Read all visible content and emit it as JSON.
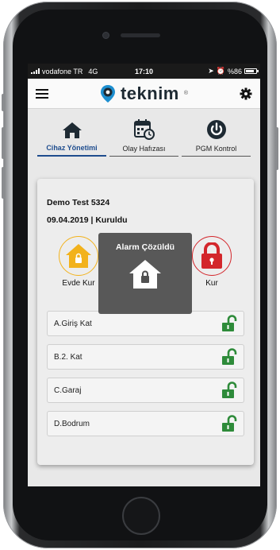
{
  "status_bar": {
    "carrier": "vodafone TR",
    "network": "4G",
    "time": "17:10",
    "battery": "%86",
    "battery_level": 0.86
  },
  "app_bar": {
    "brand": "teknim",
    "brand_mark": "®",
    "brand_color": "#1e2a33",
    "brand_pin_color": "#1d8fd0"
  },
  "tabs": [
    {
      "label": "Cihaz Yönetimi",
      "icon": "home-icon",
      "active": true
    },
    {
      "label": "Olay Hafızası",
      "icon": "calendar-clock-icon",
      "active": false
    },
    {
      "label": "PGM Kontrol",
      "icon": "power-icon",
      "active": false
    }
  ],
  "device": {
    "name": "Demo Test 5324",
    "status_line": "09.04.2019 | Kuruldu"
  },
  "modes": [
    {
      "label": "Evde Kur",
      "icon": "home-lock-icon",
      "color": "#f2b21c"
    },
    {
      "label": "Kur",
      "icon": "lock-icon",
      "color": "#d3262b"
    }
  ],
  "zones": [
    {
      "label": "A.Giriş Kat",
      "icon": "unlocked-icon"
    },
    {
      "label": "B.2. Kat",
      "icon": "unlocked-icon"
    },
    {
      "label": "C.Garaj",
      "icon": "unlocked-icon"
    },
    {
      "label": "D.Bodrum",
      "icon": "unlocked-icon"
    }
  ],
  "toast": {
    "title": "Alarm Çözüldü",
    "icon": "home-lock-icon"
  },
  "colors": {
    "accent": "#1f4d8e",
    "unlocked_green": "#2e8b3a",
    "home_yellow": "#f2b21c",
    "arm_red": "#d3262b"
  }
}
